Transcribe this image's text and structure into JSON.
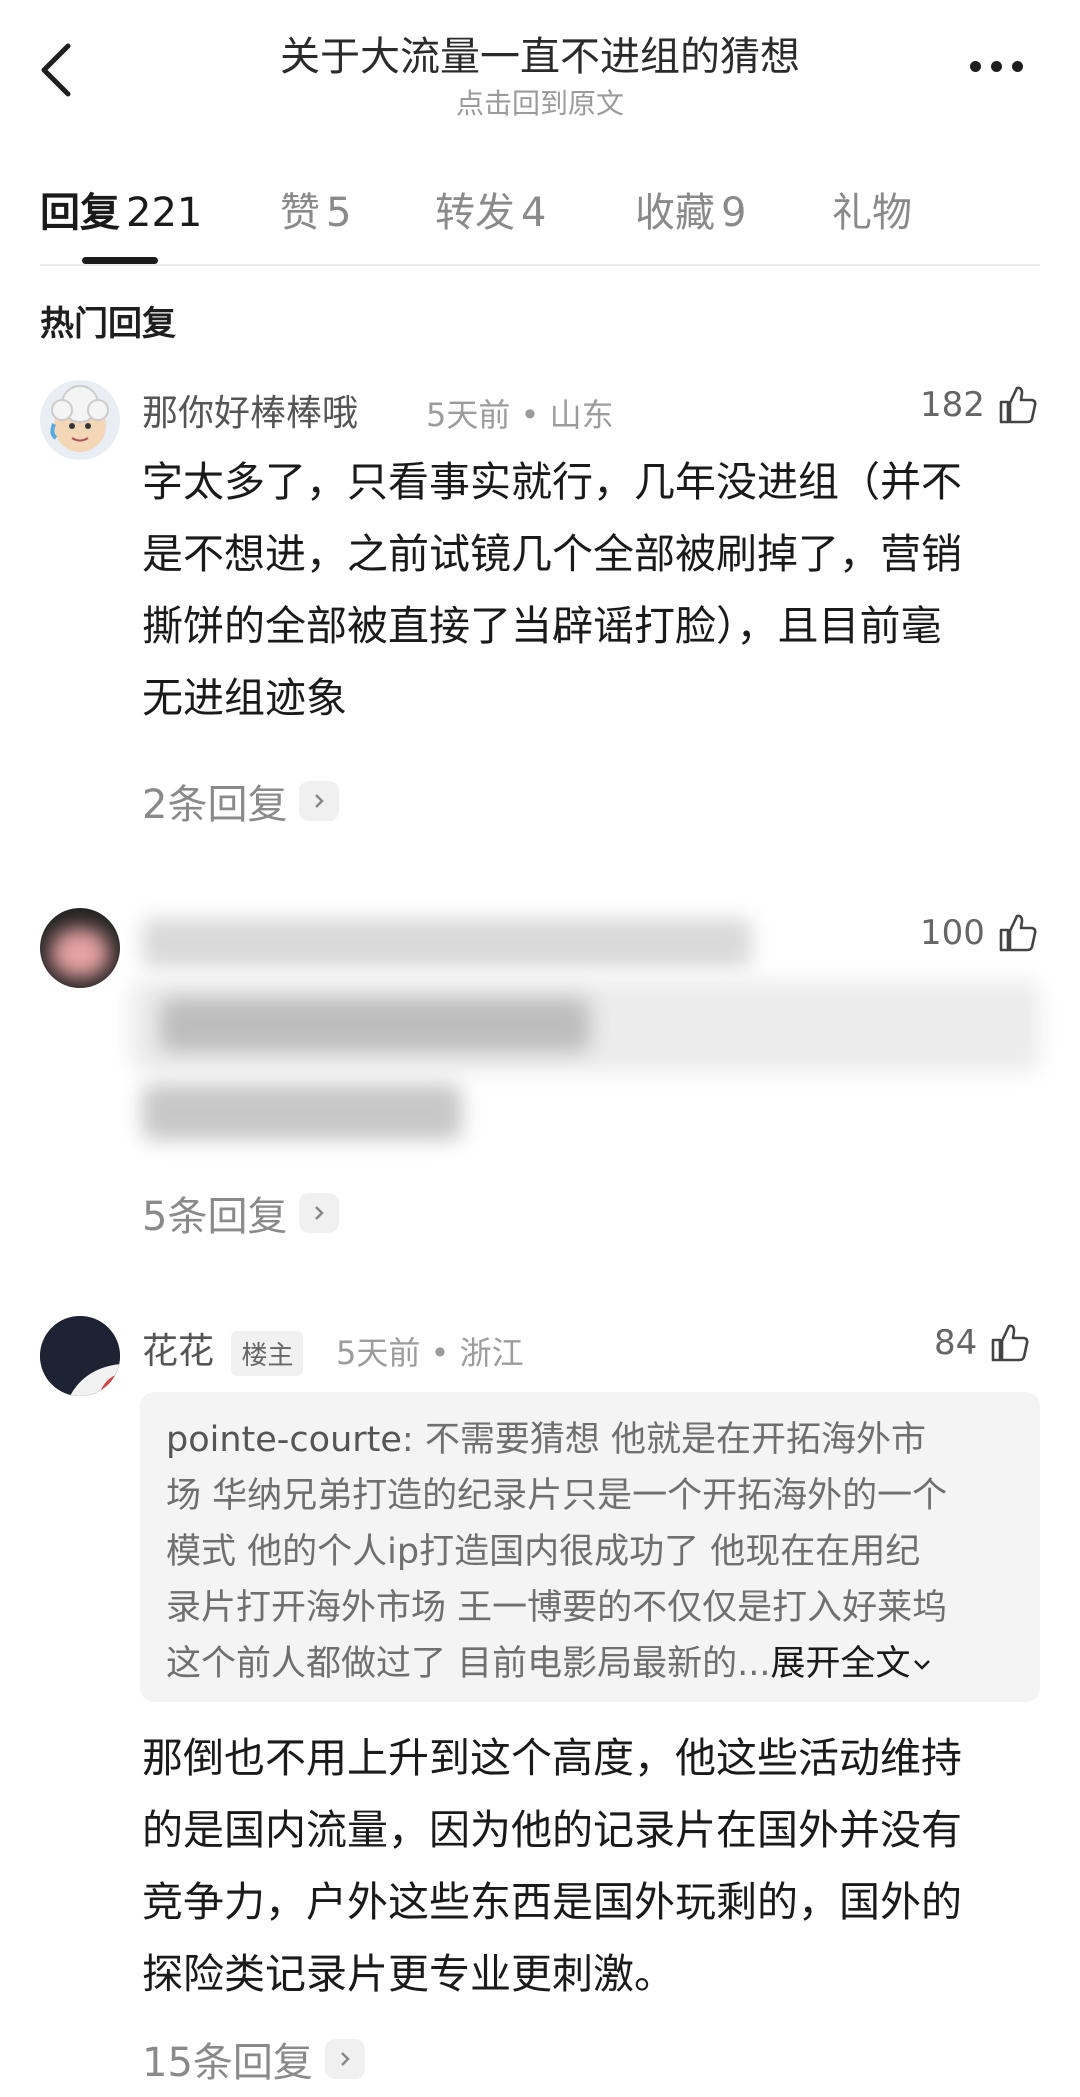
{
  "header": {
    "title": "关于大流量一直不进组的猜想",
    "subtitle": "点击回到原文"
  },
  "tabs": [
    {
      "label": "回复",
      "count": "221"
    },
    {
      "label": "赞",
      "count": "5"
    },
    {
      "label": "转发",
      "count": "4"
    },
    {
      "label": "收藏",
      "count": "9"
    },
    {
      "label": "礼物",
      "count": ""
    }
  ],
  "section_label": "热门回复",
  "comments": [
    {
      "name": "那你好棒棒哦",
      "time": "5天前",
      "location": "山东",
      "likes": "182",
      "lines": [
        "字太多了，只看事实就行，几年没进组（并不",
        "是不想进，之前试镜几个全部被刷掉了，营销",
        "撕饼的全部被直接了当辟谣打脸），且目前毫",
        "无进组迹象"
      ],
      "replies": "2条回复"
    },
    {
      "likes": "100",
      "replies": "5条回复"
    },
    {
      "name": "花花",
      "badge": "楼主",
      "time": "5天前",
      "location": "浙江",
      "likes": "84",
      "quote_author": "pointe-courte",
      "quote_lines": [
        ": 不需要猜想 他就是在开拓海外市",
        "场  华纳兄弟打造的纪录片只是一个开拓海外的一个",
        "模式  他的个人ip打造国内很成功了 他现在在用纪",
        "录片打开海外市场  王一博要的不仅仅是打入好莱坞",
        "这个前人都做过了  目前电影局最新的..."
      ],
      "quote_expand": "展开全文",
      "lines": [
        "那倒也不用上升到这个高度，他这些活动维持",
        "的是国内流量，因为他的记录片在国外并没有",
        "竞争力，户外这些东西是国外玩剩的，国外的",
        "探险类记录片更专业更刺激。"
      ],
      "replies": "15条回复"
    }
  ]
}
